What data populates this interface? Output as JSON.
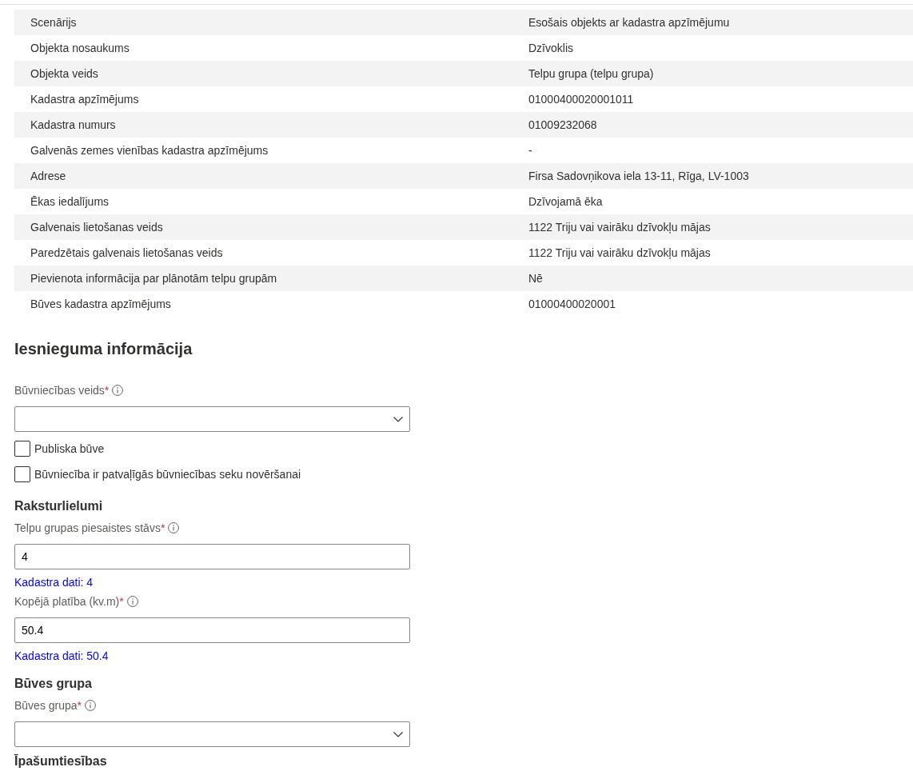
{
  "details": {
    "rows": [
      {
        "label": "Scenārijs",
        "value": "Esošais objekts ar kadastra apzīmējumu"
      },
      {
        "label": "Objekta nosaukums",
        "value": "Dzīvoklis"
      },
      {
        "label": "Objekta veids",
        "value": "Telpu grupa (telpu grupa)"
      },
      {
        "label": "Kadastra apzīmējums",
        "value": "01000400020001011"
      },
      {
        "label": "Kadastra numurs",
        "value": "01009232068"
      },
      {
        "label": "Galvenās zemes vienības kadastra apzīmējums",
        "value": "-"
      },
      {
        "label": "Adrese",
        "value": "Firsa Sadovņikova iela 13-11, Rīga, LV-1003"
      },
      {
        "label": "Ēkas iedalījums",
        "value": "Dzīvojamā ēka"
      },
      {
        "label": "Galvenais lietošanas veids",
        "value": "1122 Triju vai vairāku dzīvokļu mājas"
      },
      {
        "label": "Paredzētais galvenais lietošanas veids",
        "value": "1122 Triju vai vairāku dzīvokļu mājas"
      },
      {
        "label": "Pievienota informācija par plānotām telpu grupām",
        "value": "Nē"
      },
      {
        "label": "Būves kadastra apzīmējums",
        "value": "01000400020001"
      }
    ]
  },
  "application": {
    "title": "Iesnieguma informācija",
    "items": [
      {
        "kind": "select",
        "label": "Būvniecības veids",
        "required_mark": "*"
      },
      {
        "kind": "checkbox",
        "label": "Publiska būve",
        "checked": false
      },
      {
        "kind": "checkbox",
        "label": "Būvniecība ir patvaļīgās būvniecības seku novēršanai",
        "checked": false
      },
      {
        "kind": "heading",
        "label": "Raksturlielumi"
      },
      {
        "kind": "input",
        "label": "Telpu grupas piesaistes stāvs",
        "required_mark": "*",
        "value": "4",
        "hint": "Kadastra dati: 4"
      },
      {
        "kind": "input",
        "label": "Kopējā platība (kv.m)",
        "required_mark": "*",
        "value": "50.4",
        "hint": "Kadastra dati: 50.4"
      },
      {
        "kind": "heading",
        "label": "Būves grupa"
      },
      {
        "kind": "select",
        "label": "Būves grupa",
        "required_mark": "*"
      },
      {
        "kind": "heading",
        "label": "Īpašumtiesības"
      }
    ]
  }
}
